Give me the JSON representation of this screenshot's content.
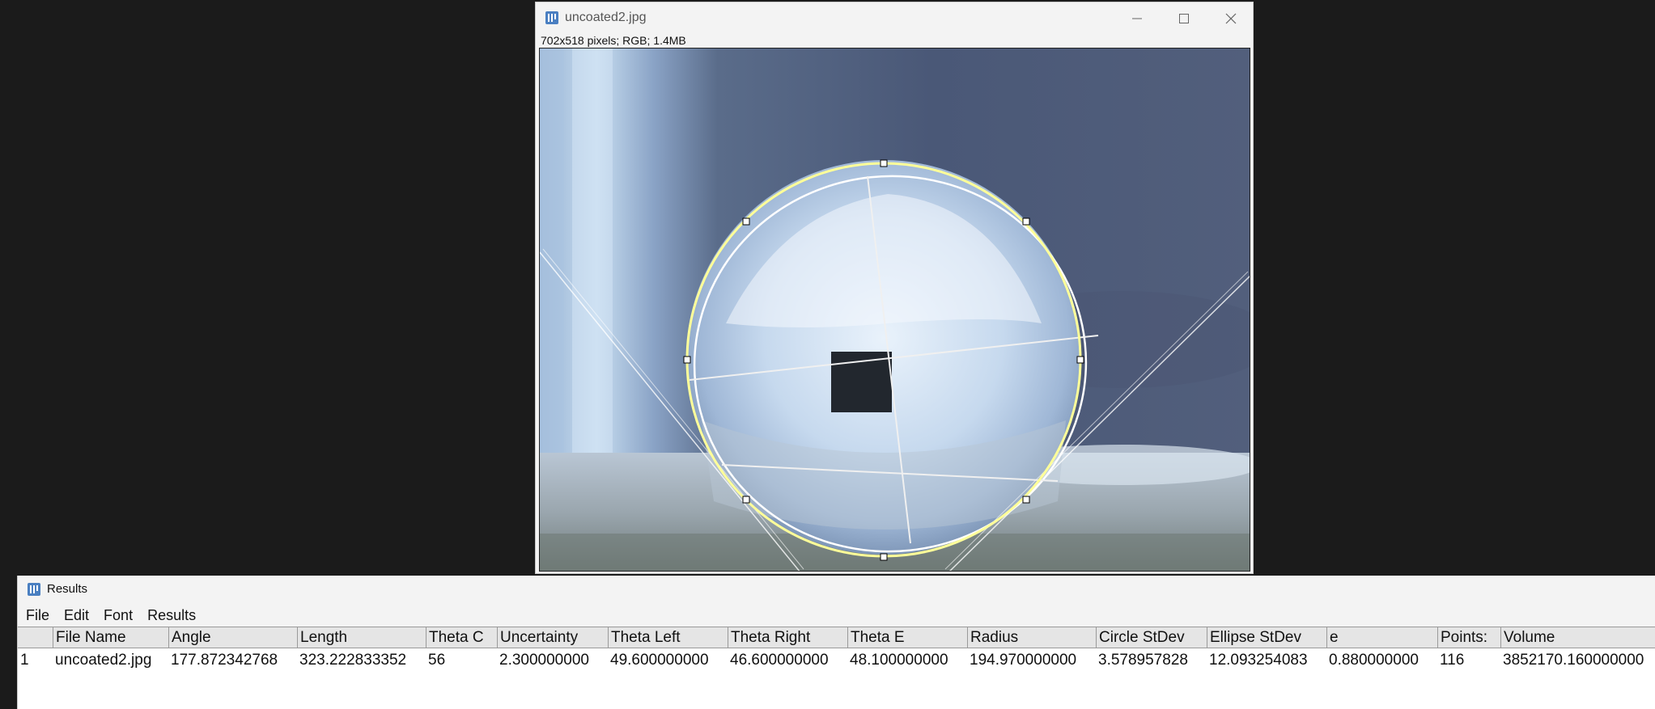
{
  "image_window": {
    "title": "uncoated2.jpg",
    "info": "702x518 pixels; RGB; 1.4MB"
  },
  "results_window": {
    "title": "Results",
    "menu": [
      "File",
      "Edit",
      "Font",
      "Results"
    ],
    "columns": [
      "",
      "File Name",
      "Angle",
      "Length",
      "Theta C",
      "Uncertainty",
      "Theta Left",
      "Theta Right",
      "Theta E",
      "Radius",
      "Circle StDev",
      "Ellipse StDev",
      "e",
      "Points:",
      "Volume"
    ],
    "rows": [
      [
        "1",
        "uncoated2.jpg",
        "177.872342768",
        "323.222833352",
        "56",
        "2.300000000",
        "49.600000000",
        "46.600000000",
        "48.100000000",
        "194.970000000",
        "3.578957828",
        "12.093254083",
        "0.880000000",
        "116",
        "3852170.160000000"
      ]
    ]
  },
  "colors": {
    "accent_icon": "#4a7fc1",
    "fit_circle": "#ffff99",
    "overlay_lines": "#ffffff"
  }
}
